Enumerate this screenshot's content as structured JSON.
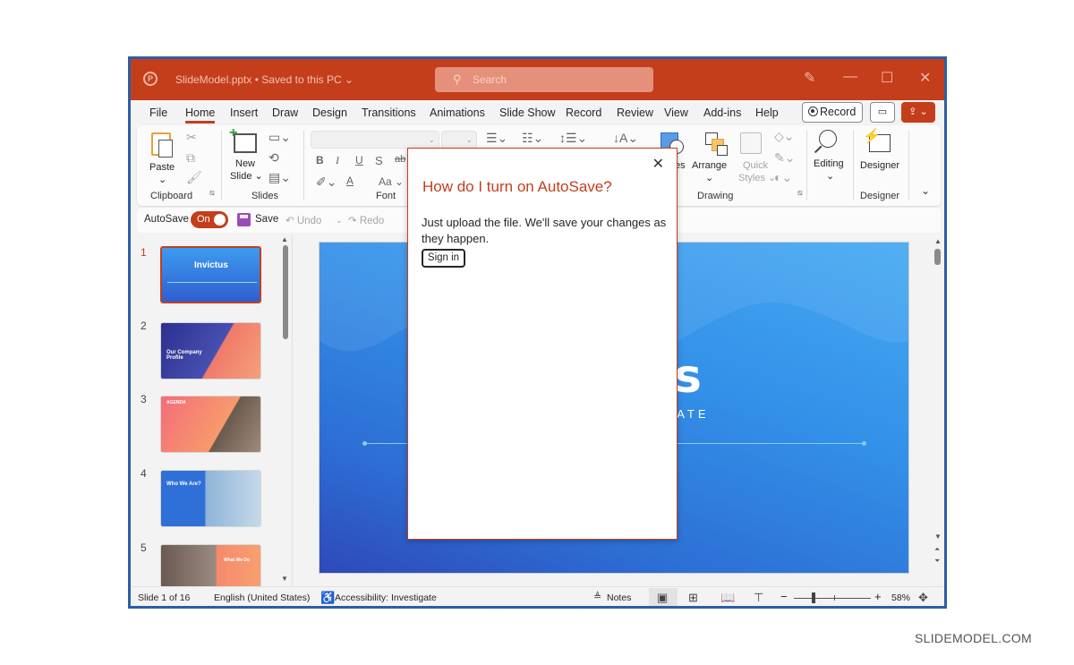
{
  "window": {
    "doc_title": "SlideModel.pptx • Saved to this PC ⌄",
    "search_placeholder": "Search",
    "controls": {
      "pen": "✎",
      "minimize": "—",
      "maximize": "☐",
      "close": "✕"
    }
  },
  "tabs": [
    {
      "label": "File"
    },
    {
      "label": "Home",
      "active": true
    },
    {
      "label": "Insert"
    },
    {
      "label": "Draw"
    },
    {
      "label": "Design"
    },
    {
      "label": "Transitions"
    },
    {
      "label": "Animations"
    },
    {
      "label": "Slide Show"
    },
    {
      "label": "Record"
    },
    {
      "label": "Review"
    },
    {
      "label": "View"
    },
    {
      "label": "Add-ins"
    },
    {
      "label": "Help"
    }
  ],
  "tab_buttons": {
    "record": "Record",
    "comment": "▭",
    "share": "⇪ ⌄"
  },
  "ribbon": {
    "clipboard": {
      "paste": "Paste",
      "paste_arrow": "⌄",
      "group": "Clipboard"
    },
    "slides": {
      "new_slide_line1": "New",
      "new_slide_line2": "Slide ⌄",
      "group": "Slides"
    },
    "font": {
      "bold": "B",
      "italic": "I",
      "underline": "U",
      "shadow": "S",
      "strike": "ab",
      "case": "Aa ⌄",
      "font_color": "A",
      "group": "Font"
    },
    "drawing": {
      "shapes": "es",
      "arrange": "Arrange",
      "quick_styles_line1": "Quick",
      "quick_styles_line2": "Styles ⌄",
      "group": "Drawing"
    },
    "editing": {
      "label": "Editing",
      "arrow": "⌄"
    },
    "designer": {
      "label": "Designer",
      "group": "Designer"
    },
    "collapse": "⌄"
  },
  "qat": {
    "autosave_label": "AutoSave",
    "toggle_text": "On",
    "save": "Save",
    "undo": "↶ Undo",
    "undo_arrow": "⌄",
    "redo": "↷ Redo"
  },
  "thumbnails": [
    {
      "num": "1",
      "selected": true,
      "title": "Invictus"
    },
    {
      "num": "2",
      "title": "Our Company Profile"
    },
    {
      "num": "3",
      "title": "AGENDA"
    },
    {
      "num": "4",
      "title": "Who We Are?"
    },
    {
      "num": "5",
      "title": "What We Do"
    }
  ],
  "slide": {
    "title_fragment": "us",
    "subtitle_fragment": "LATE"
  },
  "popup": {
    "close": "✕",
    "title": "How do I turn on AutoSave?",
    "body": "Just upload the file. We'll save your changes as they happen.",
    "button": "Sign in"
  },
  "statusbar": {
    "slide_info": "Slide 1 of 16",
    "language": "English (United States)",
    "accessibility": "Accessibility: Investigate",
    "notes": "Notes",
    "zoom_minus": "−",
    "zoom_plus": "+",
    "zoom_level": "58%"
  },
  "watermark": "SLIDEMODEL.COM",
  "colors": {
    "accent": "#c43e1c",
    "frame": "#2b5fa6",
    "slide_blue": "#3390e8"
  }
}
